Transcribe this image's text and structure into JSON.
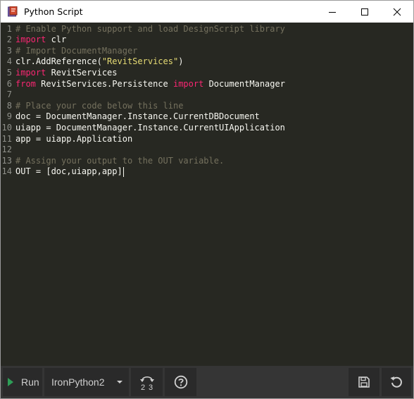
{
  "window": {
    "title": "Python Script",
    "controls": [
      "minimize",
      "maximize",
      "close"
    ]
  },
  "editor": {
    "lines": [
      {
        "n": "1",
        "tokens": [
          {
            "t": "cm",
            "v": "# Enable Python support and load DesignScript library"
          }
        ]
      },
      {
        "n": "2",
        "tokens": [
          {
            "t": "kw",
            "v": "import"
          },
          {
            "t": "tx",
            "v": " clr"
          }
        ]
      },
      {
        "n": "3",
        "tokens": [
          {
            "t": "cm",
            "v": "# Import DocumentManager"
          }
        ]
      },
      {
        "n": "4",
        "tokens": [
          {
            "t": "tx",
            "v": "clr.AddReference("
          },
          {
            "t": "str",
            "v": "\"RevitServices\""
          },
          {
            "t": "tx",
            "v": ")"
          }
        ]
      },
      {
        "n": "5",
        "tokens": [
          {
            "t": "kw",
            "v": "import"
          },
          {
            "t": "tx",
            "v": " RevitServices"
          }
        ]
      },
      {
        "n": "6",
        "tokens": [
          {
            "t": "kw",
            "v": "from"
          },
          {
            "t": "tx",
            "v": " RevitServices.Persistence "
          },
          {
            "t": "kw",
            "v": "import"
          },
          {
            "t": "tx",
            "v": " DocumentManager"
          }
        ]
      },
      {
        "n": "7",
        "tokens": []
      },
      {
        "n": "8",
        "tokens": [
          {
            "t": "cm",
            "v": "# Place your code below this line"
          }
        ]
      },
      {
        "n": "9",
        "tokens": [
          {
            "t": "tx",
            "v": "doc = DocumentManager.Instance.CurrentDBDocument"
          }
        ]
      },
      {
        "n": "10",
        "tokens": [
          {
            "t": "tx",
            "v": "uiapp = DocumentManager.Instance.CurrentUIApplication"
          }
        ]
      },
      {
        "n": "11",
        "tokens": [
          {
            "t": "tx",
            "v": "app = uiapp.Application"
          }
        ]
      },
      {
        "n": "12",
        "tokens": []
      },
      {
        "n": "13",
        "tokens": [
          {
            "t": "cm",
            "v": "# Assign your output to the OUT variable."
          }
        ]
      },
      {
        "n": "14",
        "tokens": [
          {
            "t": "tx",
            "v": "OUT = [doc,uiapp,app]"
          }
        ],
        "caret": true
      }
    ]
  },
  "toolbar": {
    "run_label": "Run",
    "engine": "IronPython2"
  },
  "colors": {
    "editor_bg": "#272822",
    "comment": "#75715e",
    "keyword": "#f92672",
    "string": "#e6db74",
    "text": "#f8f8f2",
    "run_icon": "#2e9e57"
  },
  "icons": {
    "app": "python-script-icon",
    "run": "play-icon",
    "engine_dropdown": "caret-down-icon",
    "migrate": "migrate-icon",
    "help": "help-icon",
    "save": "save-icon",
    "revert": "revert-icon"
  }
}
